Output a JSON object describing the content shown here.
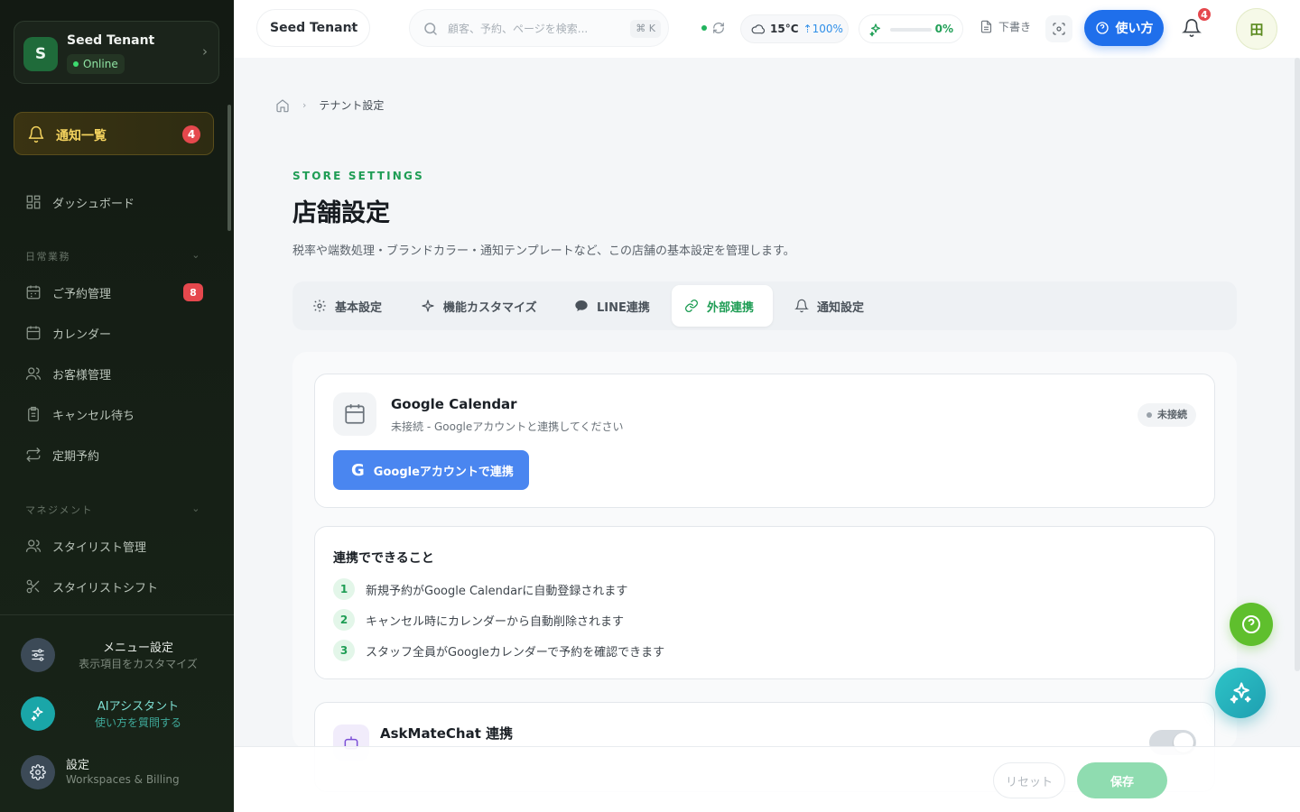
{
  "colors": {
    "sidebar_bg": "#131a13",
    "accent_green": "#1f9d55",
    "primary_blue": "#1f6feb",
    "badge_red": "#e5484d",
    "notify_gold": "#f4d35e",
    "ai_teal": "#2ec4c7",
    "help_green": "#5fbf2d"
  },
  "sidebar": {
    "tenant": {
      "initial": "S",
      "name": "Seed Tenant",
      "status": "Online"
    },
    "notifications": {
      "label": "通知一覧",
      "count": "4",
      "icon": "bell-icon"
    },
    "dashboard": {
      "label": "ダッシュボード",
      "icon": "dashboard-icon"
    },
    "sections": [
      {
        "label": "日常業務",
        "items": [
          {
            "label": "ご予約管理",
            "badge": "8",
            "icon": "calendar-grid-icon"
          },
          {
            "label": "カレンダー",
            "icon": "calendar-icon"
          },
          {
            "label": "お客様管理",
            "icon": "users-icon"
          },
          {
            "label": "キャンセル待ち",
            "icon": "clipboard-icon"
          },
          {
            "label": "定期予約",
            "icon": "repeat-icon"
          }
        ]
      },
      {
        "label": "マネジメント",
        "items": [
          {
            "label": "スタイリスト管理",
            "icon": "users-icon"
          },
          {
            "label": "スタイリストシフト",
            "icon": "scissors-icon"
          }
        ]
      }
    ],
    "footer": [
      {
        "title": "メニュー設定",
        "subtitle": "表示項目をカスタマイズ",
        "icon": "sliders-icon"
      },
      {
        "title": "AIアシスタント",
        "subtitle": "使い方を質問する",
        "icon": "sparkles-icon"
      },
      {
        "title": "設定",
        "subtitle": "Workspaces & Billing",
        "icon": "gear-icon"
      }
    ]
  },
  "topbar": {
    "tenant_select": "Seed Tenant",
    "search_placeholder": "顧客、予約、ページを検索...",
    "search_shortcut": "⌘ K",
    "weather_temp": "15°C",
    "weather_humidity": "100%",
    "progress_value": 0,
    "progress_text": "0%",
    "draft_label": "下書き",
    "help_label": "使い方",
    "bell_count": "4",
    "grid_label": "田"
  },
  "main": {
    "breadcrumb": {
      "current": "テナント設定"
    },
    "eyebrow": "STORE SETTINGS",
    "title": "店舗設定",
    "description": "税率や端数処理・ブランドカラー・通知テンプレートなど、この店舗の基本設定を管理します。",
    "tabs": [
      {
        "label": "基本設定",
        "icon": "gear-icon"
      },
      {
        "label": "機能カスタマイズ",
        "icon": "sparkle-icon"
      },
      {
        "label": "LINE連携",
        "icon": "chat-bubble-icon"
      },
      {
        "label": "外部連携",
        "icon": "link-icon",
        "active": true
      },
      {
        "label": "通知設定",
        "icon": "bell-icon"
      }
    ],
    "google_calendar": {
      "title": "Google Calendar",
      "subtitle": "未接続 - Googleアカウントと連携してください",
      "status": "未接続",
      "button": "Googleアカウントで連携",
      "button_glyph": "G"
    },
    "features": {
      "title": "連携でできること",
      "items": [
        {
          "num": "1",
          "text": "新規予約がGoogle Calendarに自動登録されます"
        },
        {
          "num": "2",
          "text": "キャンセル時にカレンダーから自動削除されます"
        },
        {
          "num": "3",
          "text": "スタッフ全員がGoogleカレンダーで予約を確認できます"
        }
      ]
    },
    "askmate": {
      "title": "AskMateChat 連携",
      "enabled": false
    }
  },
  "footer_bar": {
    "reset_label": "リセット",
    "save_label": "保存"
  }
}
